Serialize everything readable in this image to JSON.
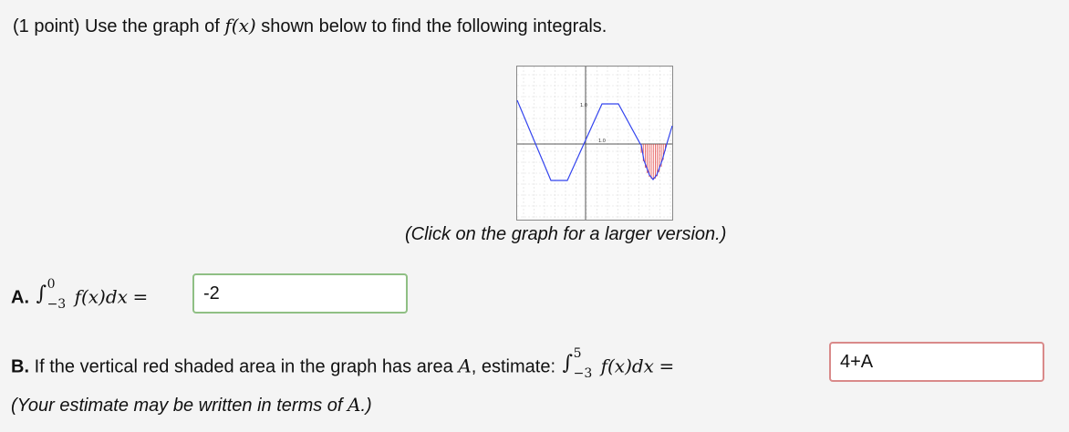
{
  "header": {
    "points": "(1 point)",
    "intro_before": "Use the graph of",
    "func": "f(x)",
    "intro_after": "shown below to find the following integrals."
  },
  "graph": {
    "caption": "(Click on the graph for a larger version.)",
    "label_y_top": "1.0",
    "label_x_right": "1.0",
    "line_color": "#3344ee",
    "shade_color": "#e23030"
  },
  "question_a": {
    "label": "A.",
    "integral_lower": "−3",
    "integral_upper": "0",
    "integrand": "f(x)dx",
    "equals": "=",
    "answer": "-2"
  },
  "question_b": {
    "label": "B.",
    "text_before": "If the vertical red shaded area in the graph has area",
    "var_a": "A",
    "text_after": ", estimate:",
    "integral_lower": "−3",
    "integral_upper": "5",
    "integrand": "f(x)dx",
    "equals": "=",
    "answer": "4+A"
  },
  "note": {
    "before": "(Your estimate may be written in terms of",
    "var": "A",
    "after": ".)"
  }
}
